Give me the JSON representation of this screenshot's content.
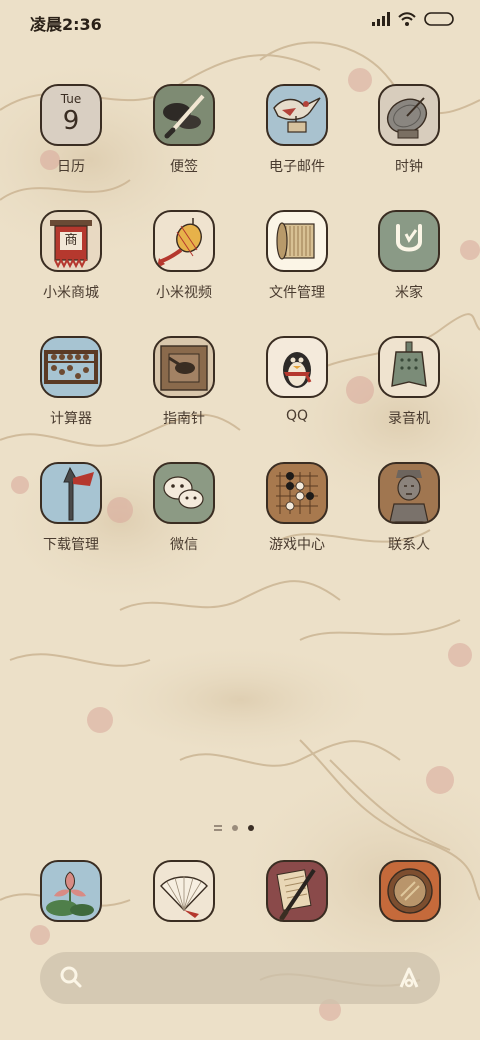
{
  "status": {
    "time": "凌晨2:36"
  },
  "apps": [
    {
      "label": "日历",
      "day": "Tue",
      "date": "9",
      "icon": "calendar-icon"
    },
    {
      "label": "便签",
      "icon": "ink-brush-icon"
    },
    {
      "label": "电子邮件",
      "icon": "crane-mail-icon"
    },
    {
      "label": "时钟",
      "icon": "sundial-icon"
    },
    {
      "label": "小米商城",
      "sign": "商",
      "icon": "shop-banner-icon"
    },
    {
      "label": "小米视频",
      "icon": "lantern-icon"
    },
    {
      "label": "文件管理",
      "icon": "scroll-icon"
    },
    {
      "label": "米家",
      "icon": "mijia-icon"
    },
    {
      "label": "计算器",
      "icon": "abacus-icon"
    },
    {
      "label": "指南针",
      "icon": "compass-spoon-icon"
    },
    {
      "label": "QQ",
      "icon": "penguin-icon"
    },
    {
      "label": "录音机",
      "icon": "bronze-bell-icon"
    },
    {
      "label": "下载管理",
      "icon": "spear-icon"
    },
    {
      "label": "微信",
      "icon": "wechat-icon"
    },
    {
      "label": "游戏中心",
      "icon": "go-board-icon"
    },
    {
      "label": "联系人",
      "icon": "terracotta-warrior-icon"
    }
  ],
  "dock": [
    {
      "icon": "lotus-icon"
    },
    {
      "icon": "folding-fan-icon"
    },
    {
      "icon": "writing-brush-icon"
    },
    {
      "icon": "bronze-mirror-icon"
    }
  ],
  "pages": {
    "count": 3,
    "active": 2
  },
  "colors": {
    "background": "#ece0c8",
    "text": "#4a3c30",
    "border": "#3a2d22"
  }
}
